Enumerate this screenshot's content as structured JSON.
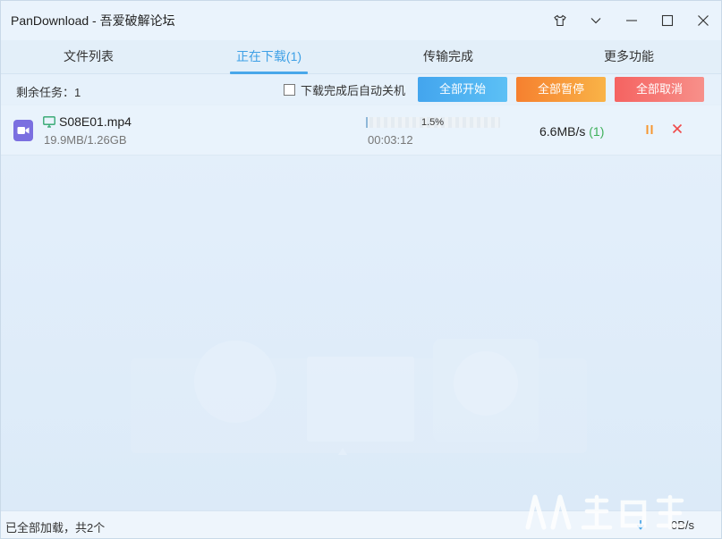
{
  "window": {
    "title": "PanDownload - 吾爱破解论坛"
  },
  "icons": {
    "skin": "tshirt-icon",
    "menu": "chevron-down-icon",
    "minimize": "minimize-icon",
    "maximize": "maximize-icon",
    "close": "close-icon"
  },
  "tabs": [
    {
      "label": "文件列表"
    },
    {
      "label": "正在下载(1)"
    },
    {
      "label": "传输完成"
    },
    {
      "label": "更多功能"
    }
  ],
  "toolbar": {
    "remaining": "剩余任务：1",
    "auto_shutdown_label": "下载完成后自动关机",
    "start_all": "全部开始",
    "pause_all": "全部暂停",
    "cancel_all": "全部取消"
  },
  "downloads": [
    {
      "name": "S08E01.mp4",
      "size": "19.9MB/1.26GB",
      "progress_percent": 1.5,
      "progress_label": "1.5%",
      "elapsed": "00:03:12",
      "speed": "6.6MB/s",
      "connections": "(1)"
    }
  ],
  "status": {
    "text": "已全部加载，共2个",
    "speed": "0B/s"
  },
  "colors": {
    "accent": "#3ea0e6",
    "start": "#43a5ee",
    "pause": "#f6802f",
    "cancel": "#f56361",
    "file_icon": "#7b6fe0",
    "connections": "#3eb05a"
  }
}
